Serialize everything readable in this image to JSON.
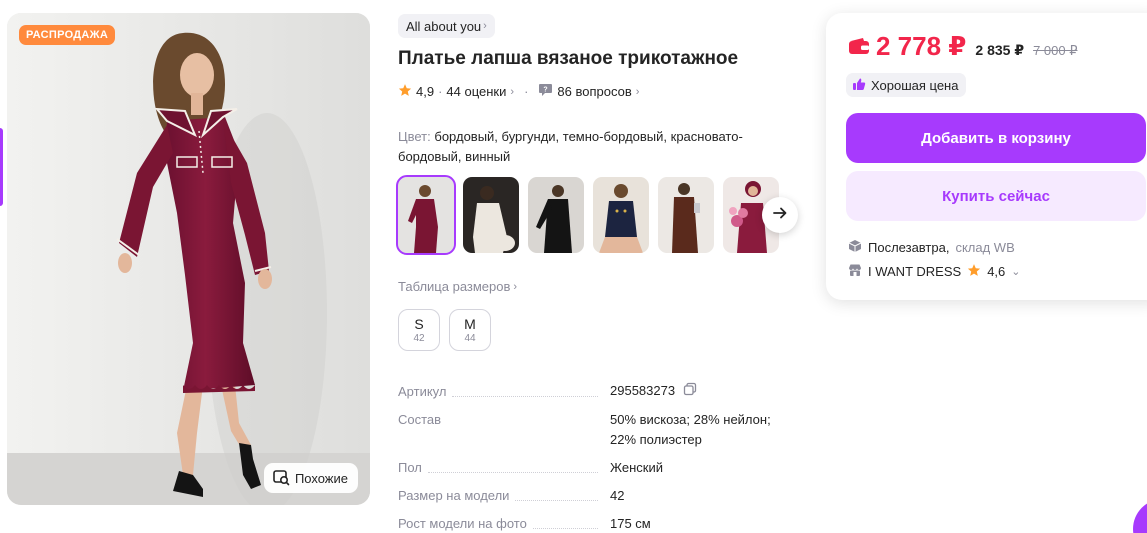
{
  "gallery": {
    "sale_badge": "РАСПРОДАЖА",
    "similar_label": "Похожие"
  },
  "product": {
    "brand": "All about you",
    "title": "Платье лапша вязаное трикотажное",
    "rating": "4,9",
    "reviews": "44 оценки",
    "questions": "86 вопросов",
    "color_label": "Цвет:",
    "colors": "бордовый, бургунди, темно-бордовый, красновато-бордовый, винный",
    "size_table_label": "Таблица размеров",
    "sizes": [
      {
        "size": "S",
        "ru": "42"
      },
      {
        "size": "M",
        "ru": "44"
      }
    ],
    "specs": [
      {
        "key": "Артикул",
        "value": "295583273"
      },
      {
        "key": "Состав",
        "value": "50% вискоза; 28% нейлон; 22% полиэстер"
      },
      {
        "key": "Пол",
        "value": "Женский"
      },
      {
        "key": "Размер на модели",
        "value": "42"
      },
      {
        "key": "Рост модели на фото",
        "value": "175 см"
      }
    ]
  },
  "buy": {
    "price": "2 778 ₽",
    "price_wallet": "2 835 ₽",
    "price_old": "7 000 ₽",
    "good_price": "Хорошая цена",
    "add_to_cart": "Добавить в корзину",
    "buy_now": "Купить сейчас",
    "delivery": "Послезавтра,",
    "warehouse": "склад WB",
    "seller": "I WANT DRESS",
    "seller_rating": "4,6"
  },
  "colors": {
    "accent": "#a73afd",
    "price": "#f2264b",
    "sale_badge": "#ff8a3d",
    "dress": "#7a1533"
  },
  "icons": [
    "chevron-right-icon",
    "star-icon",
    "question-icon",
    "arrow-right-icon",
    "copy-icon",
    "wallet-icon",
    "thumb-up-icon",
    "box-icon",
    "shop-icon",
    "chevron-down-icon",
    "similar-search-icon"
  ]
}
